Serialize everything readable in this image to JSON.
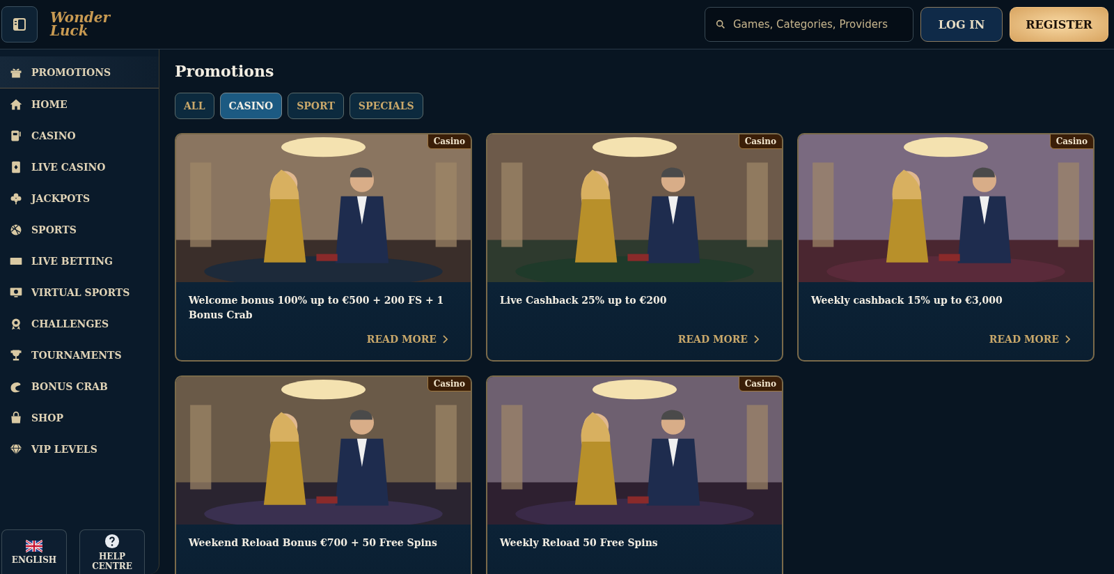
{
  "header": {
    "logo": "Wonder Luck",
    "search": {
      "placeholder": "Games, Categories, Providers"
    },
    "login": "LOG IN",
    "register": "REGISTER"
  },
  "sidebar": {
    "items": [
      {
        "label": "PROMOTIONS",
        "selected": true
      },
      {
        "label": "HOME",
        "selected": false
      },
      {
        "label": "CASINO",
        "selected": false
      },
      {
        "label": "LIVE CASINO",
        "selected": false
      },
      {
        "label": "JACKPOTS",
        "selected": false
      },
      {
        "label": "SPORTS",
        "selected": false
      },
      {
        "label": "LIVE BETTING",
        "selected": false
      },
      {
        "label": "VIRTUAL SPORTS",
        "selected": false
      },
      {
        "label": "CHALLENGES",
        "selected": false
      },
      {
        "label": "TOURNAMENTS",
        "selected": false
      },
      {
        "label": "BONUS CRAB",
        "selected": false
      },
      {
        "label": "SHOP",
        "selected": false
      },
      {
        "label": "VIP LEVELS",
        "selected": false
      }
    ],
    "language": "ENGLISH",
    "help": "HELP CENTRE"
  },
  "page": {
    "title": "Promotions",
    "filters": [
      {
        "label": "ALL",
        "selected": false
      },
      {
        "label": "CASINO",
        "selected": true
      },
      {
        "label": "SPORT",
        "selected": false
      },
      {
        "label": "SPECIALS",
        "selected": false
      }
    ],
    "promotions": [
      {
        "badge": "Casino",
        "title": "Welcome bonus 100% up to €500 + 200 FS + 1 Bonus Crab",
        "link": "READ MORE"
      },
      {
        "badge": "Casino",
        "title": "Live Cashback 25% up to €200",
        "link": "READ MORE"
      },
      {
        "badge": "Casino",
        "title": "Weekly cashback 15% up to €3,000",
        "link": "READ MORE"
      },
      {
        "badge": "Casino",
        "title": "Weekend Reload Bonus €700 + 50 Free Spins"
      },
      {
        "badge": "Casino",
        "title": "Weekly Reload 50 Free Spins"
      }
    ]
  }
}
